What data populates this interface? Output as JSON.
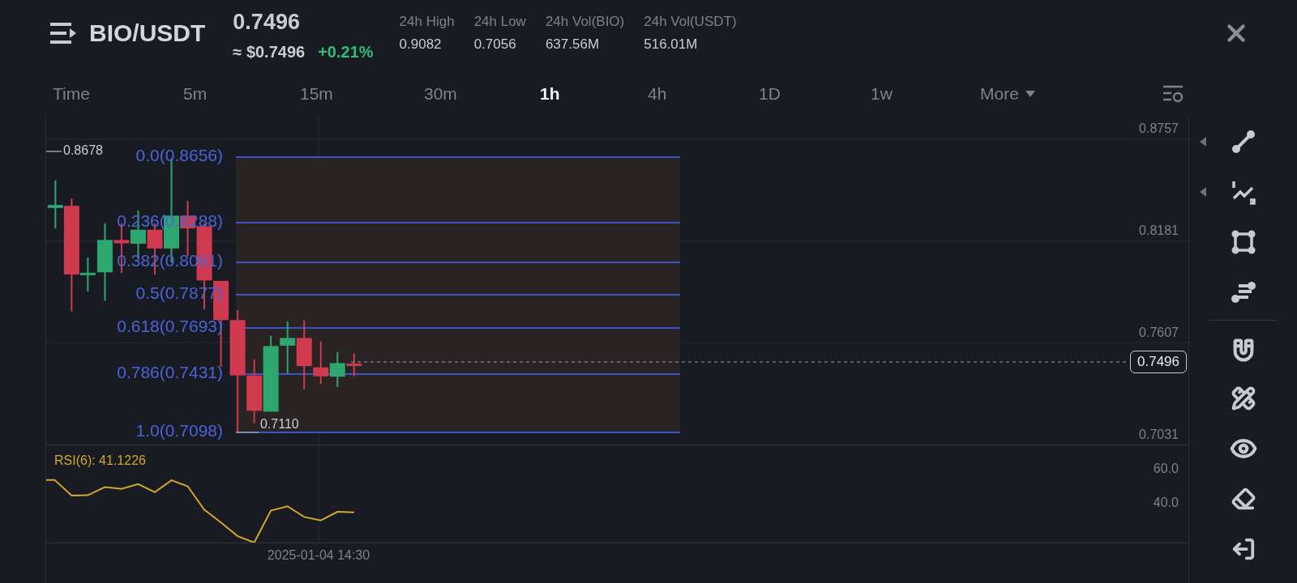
{
  "header": {
    "pair": "BIO/USDT",
    "price": "0.7496",
    "usd_price": "≈ $0.7496",
    "change": "+0.21%",
    "stats": [
      {
        "label": "24h High",
        "value": "0.9082"
      },
      {
        "label": "24h Low",
        "value": "0.7056"
      },
      {
        "label": "24h Vol(BIO)",
        "value": "637.56M"
      },
      {
        "label": "24h Vol(USDT)",
        "value": "516.01M"
      }
    ]
  },
  "intervals": [
    {
      "label": "Time",
      "selected": false
    },
    {
      "label": "5m",
      "selected": false
    },
    {
      "label": "15m",
      "selected": false
    },
    {
      "label": "30m",
      "selected": false
    },
    {
      "label": "1h",
      "selected": true
    },
    {
      "label": "4h",
      "selected": false
    },
    {
      "label": "1D",
      "selected": false
    },
    {
      "label": "1w",
      "selected": false
    },
    {
      "label": "More",
      "selected": false,
      "kind": "dropdown"
    }
  ],
  "chart": {
    "price_axis": [
      "0.8757",
      "0.8181",
      "0.7607",
      "0.7031"
    ],
    "current_price": "0.7496",
    "high_marker": "0.8678",
    "low_marker": "0.7110",
    "fib_levels": [
      "0.0(0.8656)",
      "0.236(0.8288)",
      "0.382(0.8061)",
      "0.5(0.7877)",
      "0.618(0.7693)",
      "0.786(0.7431)",
      "1.0(0.7098)"
    ]
  },
  "rsi": {
    "label": "RSI(6): 41.1226",
    "axis": [
      "60.0",
      "40.0"
    ]
  },
  "time_axis": [
    "2025-01-04 14:30"
  ]
}
